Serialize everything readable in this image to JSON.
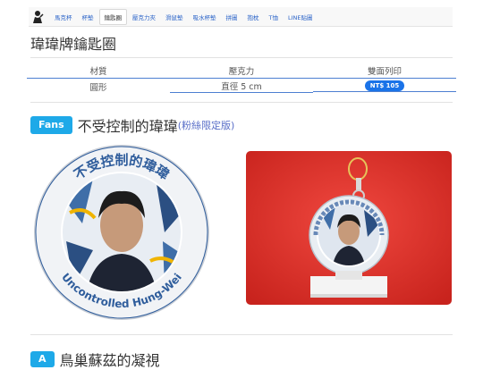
{
  "nav": {
    "tabs": [
      {
        "label": "馬克杯",
        "active": false
      },
      {
        "label": "杯墊",
        "active": false
      },
      {
        "label": "鑰匙圈",
        "active": true
      },
      {
        "label": "壓克力夾",
        "active": false
      },
      {
        "label": "滑鼠墊",
        "active": false
      },
      {
        "label": "吸水杯墊",
        "active": false
      },
      {
        "label": "拼圖",
        "active": false
      },
      {
        "label": "抱枕",
        "active": false
      },
      {
        "label": "T恤",
        "active": false
      },
      {
        "label": "LINE貼圖",
        "active": false
      }
    ]
  },
  "page_title": "瑋瑋牌鑰匙圈",
  "specs": {
    "headers": [
      "材質",
      "壓克力",
      "雙面列印"
    ],
    "values": [
      "圓形",
      "直徑 5 cm",
      "NT$ 105"
    ]
  },
  "product": {
    "badge": "Fans",
    "name": "不受控制的瑋瑋",
    "note": "(粉絲限定版)",
    "coin_top_text": "不受控制的瑋瑋",
    "coin_bottom_text": "Uncontrolled Hung-Wei"
  },
  "next_section": {
    "badge": "A",
    "name": "鳥巢蘇茲的凝視"
  },
  "colors": {
    "accent_blue": "#1ea9e8",
    "price_blue": "#1a73e8",
    "coin_ring": "#dde3ea",
    "coin_text": "#2f5d9c",
    "photo_bg": "#e0372f"
  }
}
